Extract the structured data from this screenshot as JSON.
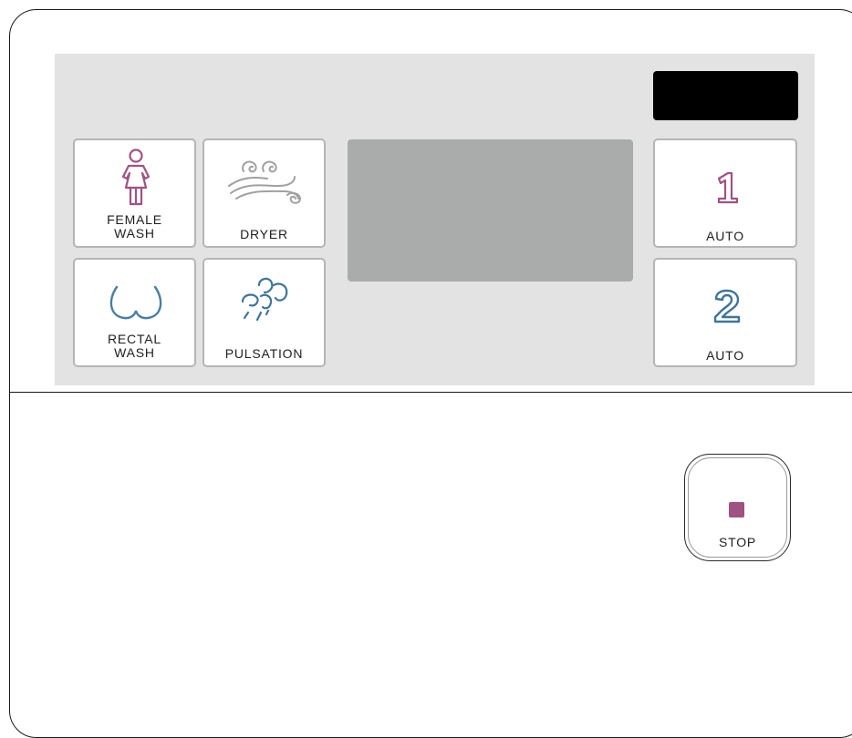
{
  "colors": {
    "female_accent": "#a05282",
    "rectal_accent": "#4a7fa0",
    "dryer_accent": "#a0a0a0",
    "pulsation_accent": "#3f7597",
    "panel_bg": "#e3e3e3",
    "display_gray": "#a9acaa",
    "display_black": "#000000"
  },
  "buttons": {
    "female_wash": {
      "label": "FEMALE\nWASH",
      "icon": "female-figure-icon"
    },
    "dryer": {
      "label": "DRYER",
      "icon": "air-swirl-icon"
    },
    "rectal_wash": {
      "label": "RECTAL\nWASH",
      "icon": "buttocks-icon"
    },
    "pulsation": {
      "label": "PULSATION",
      "icon": "water-spray-icon"
    },
    "auto1": {
      "number": "1",
      "label": "AUTO"
    },
    "auto2": {
      "number": "2",
      "label": "AUTO"
    },
    "stop": {
      "label": "STOP",
      "icon": "stop-square-icon"
    }
  }
}
